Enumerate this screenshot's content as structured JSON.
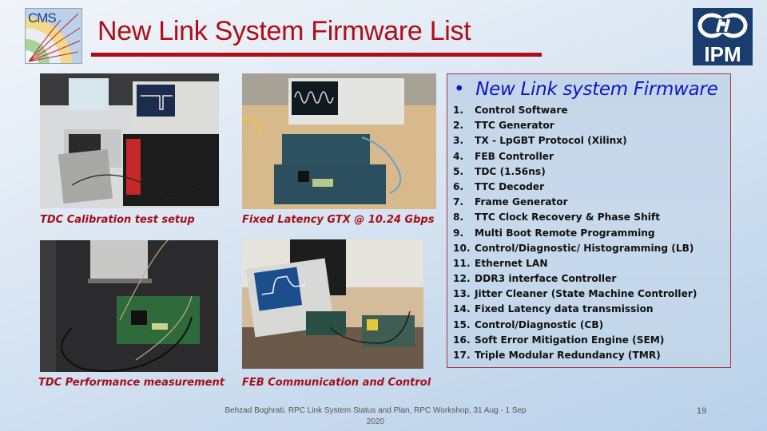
{
  "slide": {
    "title": "New Link System Firmware List",
    "logos": {
      "left": "CMS",
      "right": "IPM"
    },
    "colors": {
      "title": "#b00d17",
      "heading": "#0b17c8",
      "caption": "#a50f1b",
      "box_border": "#a83344"
    }
  },
  "photos": [
    {
      "caption": "TDC Calibration test setup",
      "subject": "oscilloscope-and-crate"
    },
    {
      "caption": "Fixed Latency GTX @ 10.24 Gbps",
      "subject": "oscilloscope-and-boards"
    },
    {
      "caption": "TDC Performance measurement",
      "subject": "fpga-board-with-cables"
    },
    {
      "caption": "FEB Communication and Control",
      "subject": "oscilloscope-and-feb-boards"
    }
  ],
  "firmware": {
    "bullet": "•",
    "heading": "New Link system Firmware",
    "items": [
      {
        "num": "1.",
        "label": "Control Software"
      },
      {
        "num": "2.",
        "label": "TTC Generator"
      },
      {
        "num": "3.",
        "label": "TX - LpGBT Protocol (Xilinx)"
      },
      {
        "num": "4.",
        "label": "FEB Controller"
      },
      {
        "num": "5.",
        "label": "TDC (1.56ns)"
      },
      {
        "num": "6.",
        "label": "TTC Decoder"
      },
      {
        "num": "7.",
        "label": "Frame Generator"
      },
      {
        "num": "8.",
        "label": "TTC Clock Recovery & Phase Shift"
      },
      {
        "num": "9.",
        "label": "Multi Boot Remote Programming"
      },
      {
        "num": "10.",
        "label": "Control/Diagnostic/ Histogramming (LB)"
      },
      {
        "num": "11.",
        "label": "Ethernet LAN"
      },
      {
        "num": "12.",
        "label": "DDR3 interface Controller"
      },
      {
        "num": "13.",
        "label": "Jitter Cleaner (State Machine Controller)"
      },
      {
        "num": "14.",
        "label": "Fixed Latency data transmission"
      },
      {
        "num": "15.",
        "label": "Control/Diagnostic (CB)"
      },
      {
        "num": "16.",
        "label": "Soft Error Mitigation Engine (SEM)"
      },
      {
        "num": "17.",
        "label": "Triple Modular Redundancy (TMR)"
      }
    ]
  },
  "footer": {
    "line1": "Behzad Boghrati, RPC Link System Status and Plan, RPC Workshop, 31 Aug - 1 Sep",
    "line2": "2020",
    "page_number": "19"
  }
}
